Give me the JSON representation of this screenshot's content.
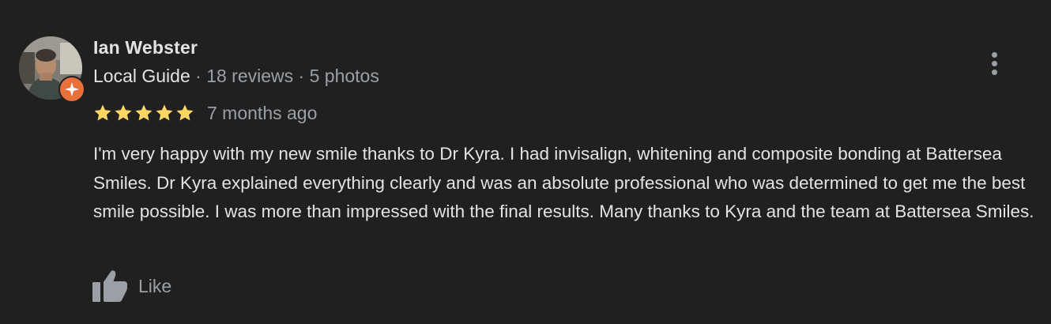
{
  "reviewer": {
    "name": "Ian Webster",
    "badge": "Local Guide",
    "separator": " · ",
    "reviews": "18 reviews",
    "photos": "5 photos"
  },
  "review": {
    "rating": 5,
    "max_rating": 5,
    "time": "7 months ago",
    "text": "I'm very happy with my new smile thanks to Dr Kyra. I had invisalign, whitening and composite bonding at Battersea Smiles. Dr Kyra explained everything clearly and was an absolute professional who was determined to get me the best smile possible. I was more than impressed with the final results. Many thanks to Kyra and the team at Battersea Smiles."
  },
  "actions": {
    "like_label": "Like"
  },
  "icons": {
    "more": "more-vert-icon",
    "like": "thumb-up-icon",
    "star": "star-icon",
    "badge": "local-guide-badge-icon"
  },
  "colors": {
    "background": "#202020",
    "primary_text": "#e3e3e3",
    "secondary_text": "#9aa0a6",
    "star": "#fdd663",
    "badge": "#e8703a"
  }
}
